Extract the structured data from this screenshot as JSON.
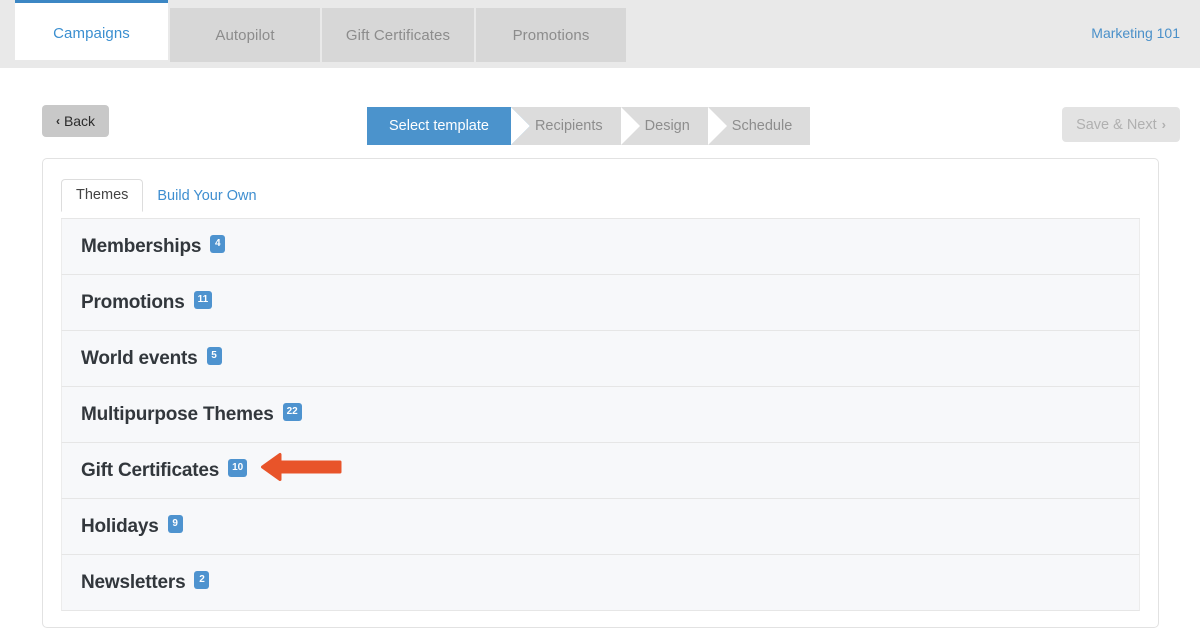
{
  "topbar": {
    "tabs": [
      {
        "label": "Campaigns",
        "active": true
      },
      {
        "label": "Autopilot",
        "active": false
      },
      {
        "label": "Gift Certificates",
        "active": false
      },
      {
        "label": "Promotions",
        "active": false
      }
    ],
    "right_link": "Marketing 101"
  },
  "actions": {
    "back_label": "Back",
    "back_chevron": "‹",
    "save_label": "Save & Next",
    "save_chevron": "›",
    "steps": [
      {
        "label": "Select template",
        "active": true
      },
      {
        "label": "Recipients",
        "active": false
      },
      {
        "label": "Design",
        "active": false
      },
      {
        "label": "Schedule",
        "active": false
      }
    ]
  },
  "panel": {
    "tabs": [
      {
        "label": "Themes",
        "active": true
      },
      {
        "label": "Build Your Own",
        "active": false
      }
    ],
    "rows": [
      {
        "label": "Memberships",
        "count": "4"
      },
      {
        "label": "Promotions",
        "count": "11"
      },
      {
        "label": "World events",
        "count": "5"
      },
      {
        "label": "Multipurpose Themes",
        "count": "22"
      },
      {
        "label": "Gift Certificates",
        "count": "10"
      },
      {
        "label": "Holidays",
        "count": "9"
      },
      {
        "label": "Newsletters",
        "count": "2"
      }
    ]
  },
  "annotation": {
    "arrow_color": "#e8542a",
    "points_to": "Gift Certificates"
  },
  "colors": {
    "accent_blue": "#4b93cc",
    "link_blue": "#3e8ed0",
    "badge_blue": "#4e93cf",
    "header_gray": "#e9e9e9",
    "row_bg": "#f7f8fa"
  }
}
